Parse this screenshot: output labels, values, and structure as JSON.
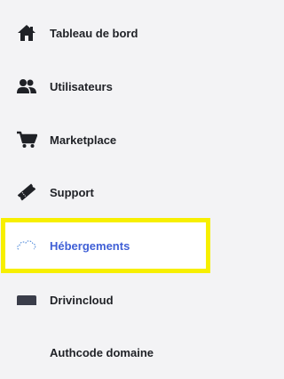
{
  "sidebar": {
    "items": [
      {
        "label": "Tableau de bord",
        "icon": "home-icon"
      },
      {
        "label": "Utilisateurs",
        "icon": "users-icon"
      },
      {
        "label": "Marketplace",
        "icon": "cart-icon"
      },
      {
        "label": "Support",
        "icon": "ticket-icon"
      },
      {
        "label": "Hébergements",
        "icon": "cloud-icon",
        "active": true
      },
      {
        "label": "Drivincloud",
        "icon": "drive-icon"
      },
      {
        "label": "Authcode domaine",
        "icon": ""
      }
    ]
  },
  "colors": {
    "background": "#f3f3f5",
    "text": "#1f2126",
    "active_text": "#3f5fd6",
    "highlight": "#f7ef00"
  }
}
